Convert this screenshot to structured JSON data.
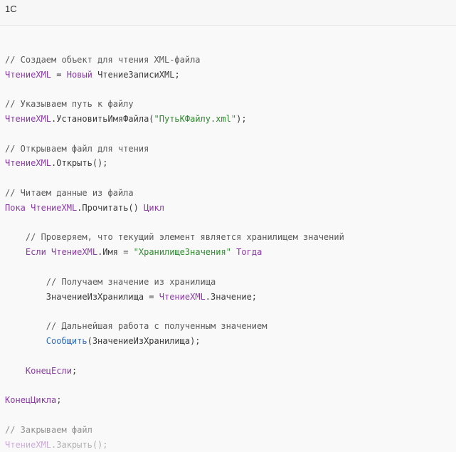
{
  "code_block": {
    "language": "1С",
    "lines": [
      [],
      [
        {
          "t": "// Создаем объект для чтения XML-файла",
          "c": "comment"
        }
      ],
      [
        {
          "t": "ЧтениеXML",
          "c": "var"
        },
        {
          "t": " = ",
          "c": "plain"
        },
        {
          "t": "Новый",
          "c": "kw"
        },
        {
          "t": " ЧтениеЗаписиXML;",
          "c": "plain"
        }
      ],
      [],
      [
        {
          "t": "// Указываем путь к файлу",
          "c": "comment"
        }
      ],
      [
        {
          "t": "ЧтениеXML",
          "c": "var"
        },
        {
          "t": ".УстановитьИмяФайла(",
          "c": "plain"
        },
        {
          "t": "\"ПутьКФайлу.xml\"",
          "c": "str"
        },
        {
          "t": ");",
          "c": "plain"
        }
      ],
      [],
      [
        {
          "t": "// Открываем файл для чтения",
          "c": "comment"
        }
      ],
      [
        {
          "t": "ЧтениеXML",
          "c": "var"
        },
        {
          "t": ".Открыть();",
          "c": "plain"
        }
      ],
      [],
      [
        {
          "t": "// Читаем данные из файла",
          "c": "comment"
        }
      ],
      [
        {
          "t": "Пока",
          "c": "kw"
        },
        {
          "t": " ",
          "c": "plain"
        },
        {
          "t": "ЧтениеXML",
          "c": "var"
        },
        {
          "t": ".Прочитать() ",
          "c": "plain"
        },
        {
          "t": "Цикл",
          "c": "kw"
        }
      ],
      [],
      [
        {
          "t": "    // Проверяем, что текущий элемент является хранилищем значений",
          "c": "comment"
        }
      ],
      [
        {
          "t": "    ",
          "c": "plain"
        },
        {
          "t": "Если",
          "c": "kw"
        },
        {
          "t": " ",
          "c": "plain"
        },
        {
          "t": "ЧтениеXML",
          "c": "var"
        },
        {
          "t": ".Имя = ",
          "c": "plain"
        },
        {
          "t": "\"ХранилищеЗначения\"",
          "c": "str"
        },
        {
          "t": " ",
          "c": "plain"
        },
        {
          "t": "Тогда",
          "c": "kw"
        }
      ],
      [],
      [
        {
          "t": "        // Получаем значение из хранилища",
          "c": "comment"
        }
      ],
      [
        {
          "t": "        ЗначениеИзХранилища = ",
          "c": "plain"
        },
        {
          "t": "ЧтениеXML",
          "c": "var"
        },
        {
          "t": ".Значение;",
          "c": "plain"
        }
      ],
      [],
      [
        {
          "t": "        // Дальнейшая работа с полученным значением",
          "c": "comment"
        }
      ],
      [
        {
          "t": "        ",
          "c": "plain"
        },
        {
          "t": "Сообщить",
          "c": "fn"
        },
        {
          "t": "(ЗначениеИзХранилища);",
          "c": "plain"
        }
      ],
      [],
      [
        {
          "t": "    ",
          "c": "plain"
        },
        {
          "t": "КонецЕсли",
          "c": "kw"
        },
        {
          "t": ";",
          "c": "plain"
        }
      ],
      [],
      [
        {
          "t": "КонецЦикла",
          "c": "kw"
        },
        {
          "t": ";",
          "c": "plain"
        }
      ],
      [],
      [
        {
          "t": "// Закрываем файл",
          "c": "comment"
        }
      ],
      [
        {
          "t": "ЧтениеXML",
          "c": "var"
        },
        {
          "t": ".Закрыть();",
          "c": "plain"
        }
      ]
    ]
  },
  "colors": {
    "comment": "#5a5a5a",
    "variable": "#8b3aa6",
    "keyword": "#8b3aa6",
    "string": "#2e8b2e",
    "function": "#2f6cbf",
    "background": "#f9f9fa"
  }
}
